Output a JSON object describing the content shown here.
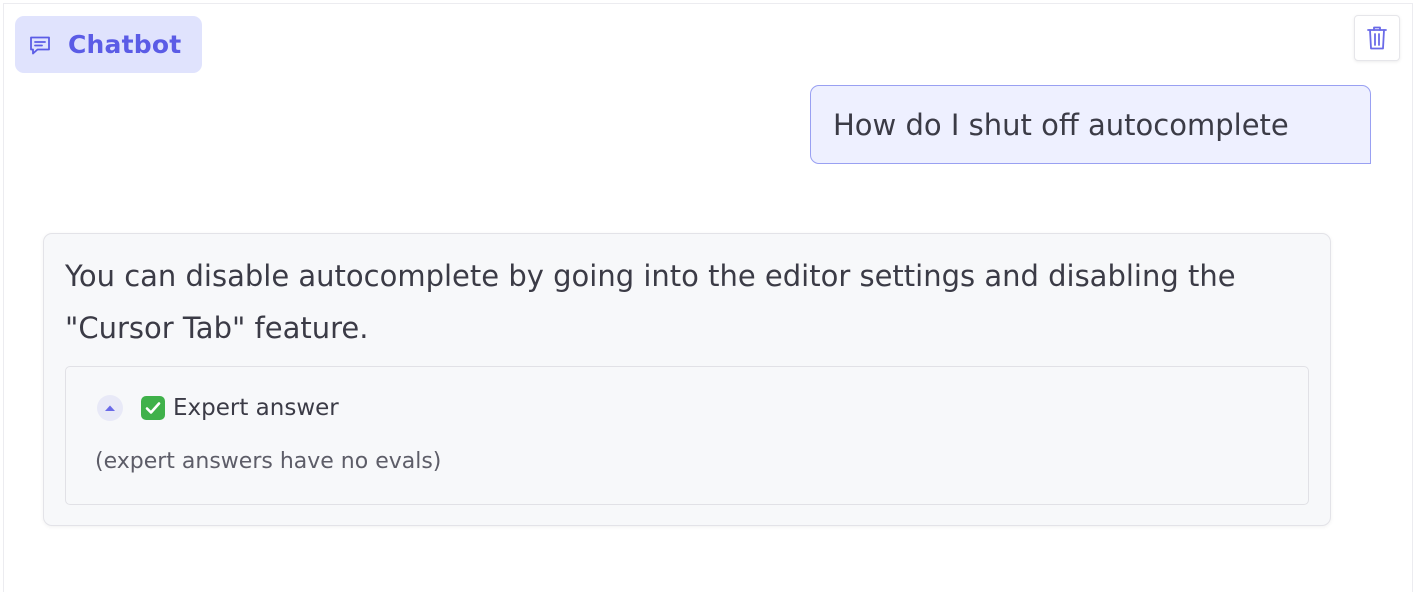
{
  "header": {
    "title": "Chatbot",
    "icon": "chat-bubble-icon",
    "accent_color": "#5b5ce6",
    "background_color": "#e0e3fd"
  },
  "toolbar": {
    "clear_icon": "trash-icon"
  },
  "conversation": {
    "user_message": "How do I shut off autocomplete",
    "bot_message": "You can disable autocomplete by going into the editor settings and disabling the \"Cursor Tab\" feature.",
    "expert_panel": {
      "toggle_icon": "chevron-up-icon",
      "check_icon": "check-mark-icon",
      "label": "Expert answer",
      "note": "(expert answers have no evals)",
      "expanded": true
    }
  },
  "colors": {
    "user_bubble_border": "#99a0f2",
    "user_bubble_bg": "#eef0ff",
    "bot_bubble_bg": "#f7f8fa",
    "check_green": "#3fb14a"
  }
}
